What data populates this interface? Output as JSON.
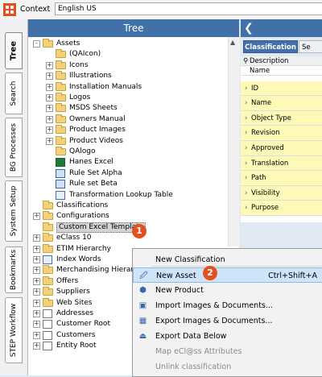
{
  "topbar": {
    "context_label": "Context",
    "context_value": "English US"
  },
  "sidetabs": [
    "Tree",
    "Search",
    "BG Processes",
    "System Setup",
    "Bookmarks",
    "STEP Workflow"
  ],
  "tree": {
    "header": "Tree",
    "rows": [
      {
        "label": "Assets",
        "icon": "folder-icon",
        "exp": "-"
      },
      {
        "label": "(QAIcon)",
        "icon": "folder-icon",
        "exp": ""
      },
      {
        "label": "Icons",
        "icon": "folder-icon",
        "exp": "+"
      },
      {
        "label": "Illustrations",
        "icon": "folder-icon",
        "exp": "+"
      },
      {
        "label": "Installation Manuals",
        "icon": "folder-icon",
        "exp": "+"
      },
      {
        "label": "Logos",
        "icon": "folder-icon",
        "exp": "+"
      },
      {
        "label": "MSDS Sheets",
        "icon": "folder-icon",
        "exp": "+"
      },
      {
        "label": "Owners Manual",
        "icon": "folder-icon",
        "exp": "+"
      },
      {
        "label": "Product Images",
        "icon": "folder-icon",
        "exp": "+"
      },
      {
        "label": "Product Videos",
        "icon": "folder-icon",
        "exp": "+"
      },
      {
        "label": "QAlogo",
        "icon": "folder-icon",
        "exp": ""
      },
      {
        "label": "Hanes Excel",
        "icon": "excel-icon",
        "exp": ""
      },
      {
        "label": "Rule Set Alpha",
        "icon": "rule-icon",
        "exp": ""
      },
      {
        "label": "Rule set Beta",
        "icon": "rule-icon",
        "exp": ""
      },
      {
        "label": "Transformation Lookup Table",
        "icon": "lookup-table-icon",
        "exp": ""
      },
      {
        "label": "Classifications",
        "icon": "folder-icon",
        "exp": ""
      },
      {
        "label": "Configurations",
        "icon": "folder-icon",
        "exp": "+"
      },
      {
        "label": "Custom Excel Template",
        "icon": "folder-icon",
        "exp": ""
      },
      {
        "label": "eClass 10",
        "icon": "folder-icon",
        "exp": "+"
      },
      {
        "label": "ETIM Hierarchy",
        "icon": "folder-icon",
        "exp": "+"
      },
      {
        "label": "Index Words",
        "icon": "index-words-icon",
        "exp": "+"
      },
      {
        "label": "Merchandising Hierarch",
        "icon": "folder-icon",
        "exp": "+"
      },
      {
        "label": "Offers",
        "icon": "folder-icon",
        "exp": "+"
      },
      {
        "label": "Suppliers",
        "icon": "folder-icon",
        "exp": "+"
      },
      {
        "label": "Web Sites",
        "icon": "folder-icon",
        "exp": "+"
      },
      {
        "label": "Addresses",
        "icon": "root-icon",
        "exp": "+"
      },
      {
        "label": "Customer Root",
        "icon": "root-icon",
        "exp": "+"
      },
      {
        "label": "Customers",
        "icon": "root-icon",
        "exp": "+"
      },
      {
        "label": "Entity Root",
        "icon": "root-icon",
        "exp": "+"
      }
    ]
  },
  "right_panel": {
    "tabs": [
      "Classification",
      "Se"
    ],
    "rows": [
      "Description",
      "Name",
      "ID",
      "Name",
      "Object Type",
      "Revision",
      "Approved",
      "Translation",
      "Path",
      "Visibility",
      "Purpose"
    ]
  },
  "context_menu": {
    "items": [
      {
        "label": "New Classification",
        "shortcut": "",
        "disabled": false,
        "icon": ""
      },
      {
        "label": "New Asset",
        "shortcut": "Ctrl+Shift+A",
        "disabled": false,
        "icon": "new-asset-icon"
      },
      {
        "label": "New Product",
        "shortcut": "",
        "disabled": false,
        "icon": "new-product-icon"
      },
      {
        "label": "Import Images & Documents...",
        "shortcut": "",
        "disabled": false,
        "icon": "import-icon"
      },
      {
        "label": "Export Images & Documents...",
        "shortcut": "",
        "disabled": false,
        "icon": "export-icon"
      },
      {
        "label": "Export Data Below",
        "shortcut": "",
        "disabled": false,
        "icon": "export-data-icon"
      },
      {
        "label": "Map eCl@ss Attributes",
        "shortcut": "",
        "disabled": true,
        "icon": ""
      },
      {
        "label": "Unlink classification",
        "shortcut": "",
        "disabled": true,
        "icon": ""
      }
    ]
  },
  "callouts": [
    "1",
    "2"
  ]
}
